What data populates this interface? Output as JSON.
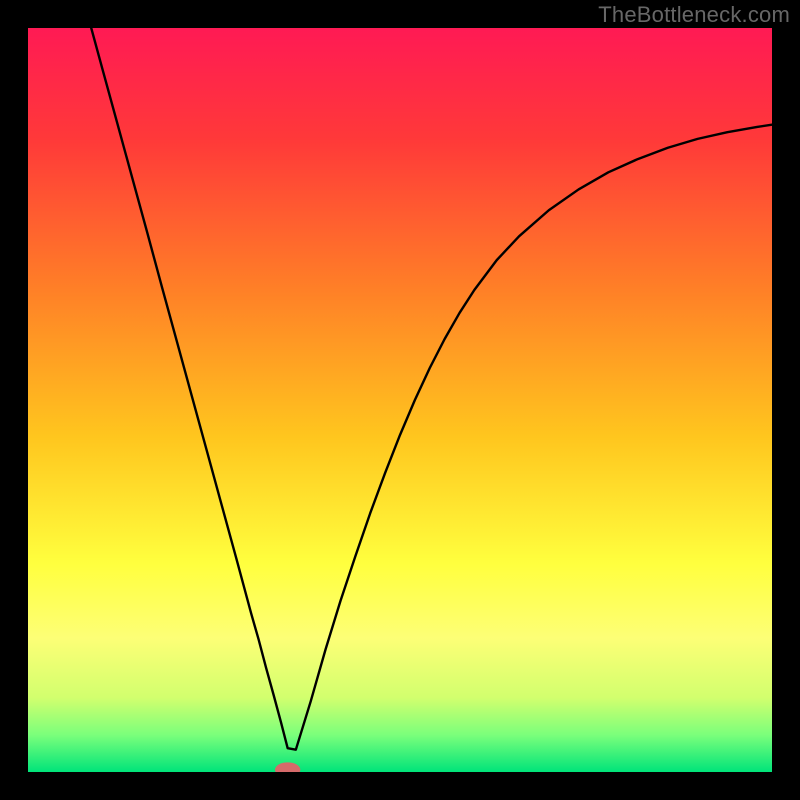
{
  "watermark": "TheBottleneck.com",
  "chart_data": {
    "type": "line",
    "title": "",
    "xlabel": "",
    "ylabel": "",
    "xlim": [
      0,
      100
    ],
    "ylim": [
      0,
      100
    ],
    "background_gradient": {
      "stops": [
        {
          "offset": 0.0,
          "color": "#ff1a54"
        },
        {
          "offset": 0.15,
          "color": "#ff3939"
        },
        {
          "offset": 0.35,
          "color": "#ff7f27"
        },
        {
          "offset": 0.55,
          "color": "#ffc61e"
        },
        {
          "offset": 0.72,
          "color": "#ffff3e"
        },
        {
          "offset": 0.82,
          "color": "#fdff76"
        },
        {
          "offset": 0.9,
          "color": "#d2ff6e"
        },
        {
          "offset": 0.95,
          "color": "#7bff7b"
        },
        {
          "offset": 1.0,
          "color": "#00e47a"
        }
      ]
    },
    "series": [
      {
        "name": "bottleneck-curve",
        "color": "#000000",
        "width": 2.4,
        "x": [
          8.5,
          10,
          12,
          14,
          16,
          18,
          20,
          22,
          24,
          26,
          28,
          30,
          31,
          32,
          33,
          34,
          34.9,
          36,
          38,
          40,
          42,
          44,
          46,
          48,
          50,
          52,
          54,
          56,
          58,
          60,
          63,
          66,
          70,
          74,
          78,
          82,
          86,
          90,
          94,
          98,
          100
        ],
        "y": [
          100,
          94.5,
          87.2,
          79.9,
          72.6,
          65.2,
          57.9,
          50.6,
          43.3,
          36.0,
          28.7,
          21.3,
          17.8,
          14.0,
          10.4,
          6.7,
          3.2,
          3.0,
          9.5,
          16.5,
          23.0,
          29.0,
          34.8,
          40.2,
          45.3,
          50.0,
          54.3,
          58.2,
          61.7,
          64.8,
          68.8,
          72.0,
          75.5,
          78.3,
          80.6,
          82.4,
          83.9,
          85.1,
          86.0,
          86.7,
          87.0
        ]
      }
    ],
    "marker": {
      "name": "optimal-point",
      "cx": 34.9,
      "cy": 0.3,
      "rx": 1.7,
      "ry": 1.0,
      "fill": "#d56a6a"
    }
  }
}
